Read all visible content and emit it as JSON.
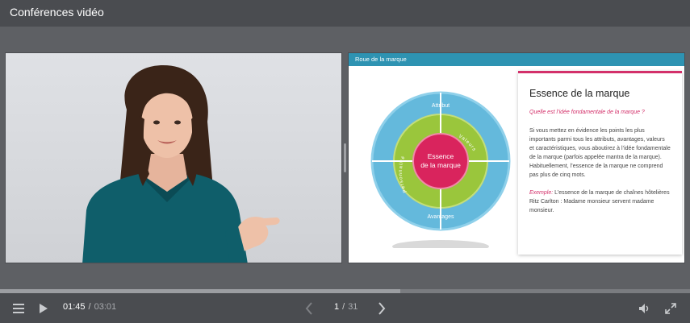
{
  "window": {
    "title": "Conférences vidéo"
  },
  "slide": {
    "header": "Roue de la marque",
    "wheel": {
      "center_line1": "Essence",
      "center_line2": "de la marque",
      "top_label": "Attribut",
      "bottom_label": "Avantages",
      "left_label": "Personnalité",
      "right_label": "Valeurs",
      "colors": {
        "outer": "#64b9dc",
        "middle": "#9ac63c",
        "center": "#d9245d"
      }
    },
    "card": {
      "title": "Essence de la marque",
      "question": "Quelle est l’idée fondamentale de la marque ?",
      "body": "Si vous mettez en évidence les points les plus importants parmi tous les attributs, avantages, valeurs et caractéristiques, vous aboutirez à l’idée fondamentale de la marque (parfois appelée mantra de la marque). Habituellement, l’essence de la marque ne comprend pas plus de cinq mots.",
      "example_label": "Exemple:",
      "example_text": "L’essence de la marque de chaînes hôtelières Ritz Carlton : Madame monsieur servent madame monsieur.",
      "accent": "#d3306a"
    }
  },
  "player": {
    "current_time": "01:45",
    "time_separator": "/",
    "total_time": "03:01",
    "progress": 0.58,
    "current_slide": "1",
    "slide_separator": "/",
    "total_slides": "31",
    "icons": {
      "menu": "menu-icon",
      "play": "play-icon",
      "prev": "chevron-left-icon",
      "next": "chevron-right-icon",
      "volume": "volume-icon",
      "fullscreen": "fullscreen-icon"
    }
  }
}
